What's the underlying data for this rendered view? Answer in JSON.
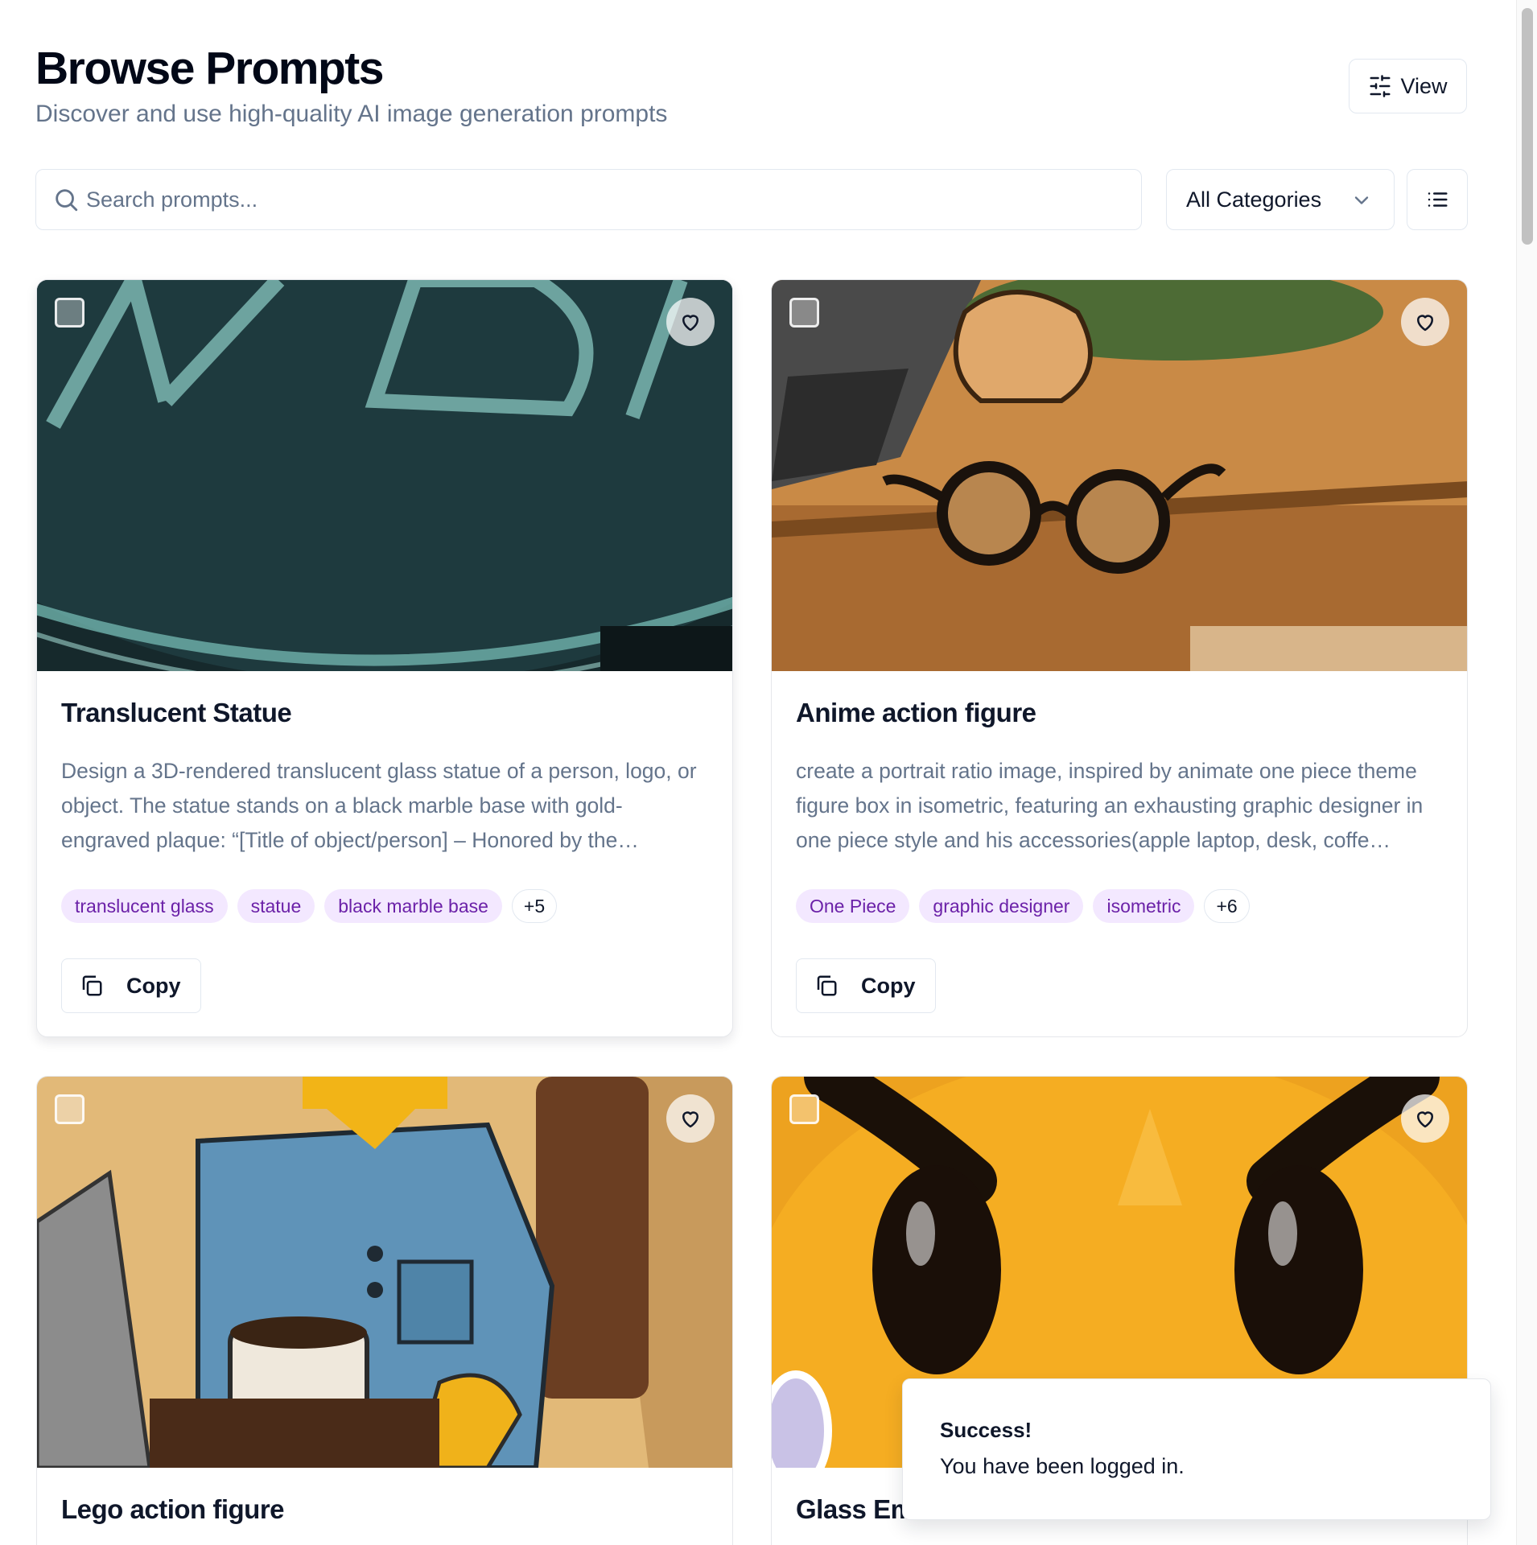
{
  "header": {
    "title": "Browse Prompts",
    "subtitle": "Discover and use high-quality AI image generation prompts",
    "view_label": "View"
  },
  "search": {
    "placeholder": "Search prompts...",
    "value": ""
  },
  "filters": {
    "category_selected": "All Categories"
  },
  "cards": [
    {
      "title": "Translucent Statue",
      "description": "Design a 3D-rendered translucent glass statue of a person, logo, or object. The statue stands on a black marble base with gold-engraved plaque: “[Title of object/person] – Honored by the…",
      "tags": [
        "translucent glass",
        "statue",
        "black marble base"
      ],
      "more_tags": "+5",
      "copy_label": "Copy",
      "checked": false,
      "favorited": false
    },
    {
      "title": "Anime action figure",
      "description": "create a portrait ratio image, inspired by animate one piece theme figure box in isometric, featuring an exhausting graphic designer in one piece style and his accessories(apple laptop, desk, coffe…",
      "tags": [
        "One Piece",
        "graphic designer",
        "isometric"
      ],
      "more_tags": "+6",
      "copy_label": "Copy",
      "checked": false,
      "favorited": false
    },
    {
      "title": "Lego action figure",
      "checked": false,
      "favorited": false
    },
    {
      "title": "Glass Em",
      "checked": false,
      "favorited": false
    }
  ],
  "toast": {
    "title": "Success!",
    "message": "You have been logged in."
  },
  "colors": {
    "tag_bg": "#f3e8ff",
    "tag_text": "#6b21a8",
    "muted_text": "#64748b",
    "border": "#e2e8f0"
  }
}
